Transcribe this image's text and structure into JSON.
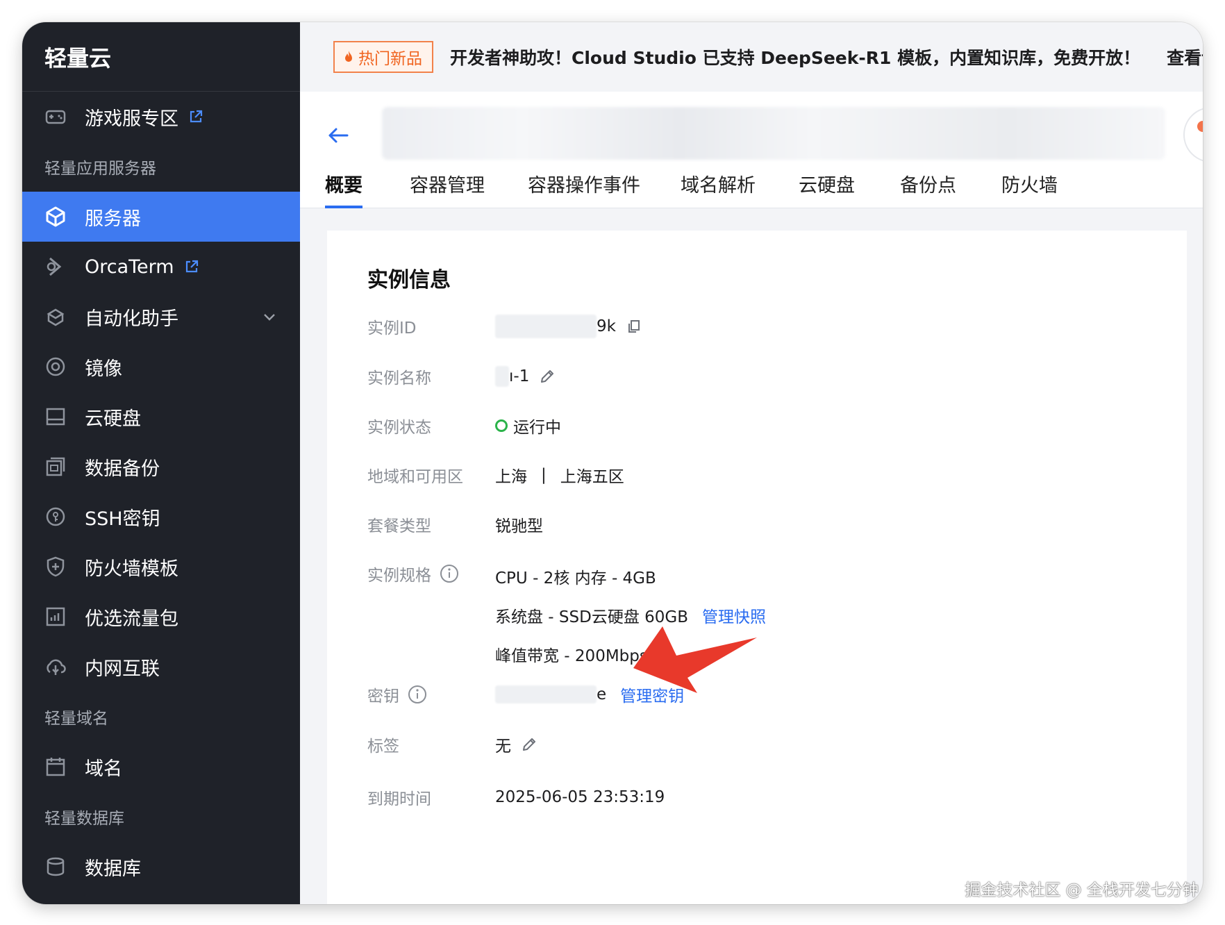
{
  "app": {
    "brand": "轻量云"
  },
  "sidebar": {
    "items": [
      {
        "type": "item",
        "name": "sidebar-item-game-server",
        "icon": "gamepad-icon",
        "label": "游戏服专区",
        "external": true
      },
      {
        "type": "group",
        "name": "sidebar-group-light-app",
        "label": "轻量应用服务器"
      },
      {
        "type": "item",
        "name": "sidebar-item-servers",
        "icon": "cube-icon",
        "label": "服务器",
        "active": true
      },
      {
        "type": "item",
        "name": "sidebar-item-orcaterm",
        "icon": "terminal-icon",
        "label": "OrcaTerm",
        "external": true
      },
      {
        "type": "item",
        "name": "sidebar-item-automation",
        "icon": "robot-icon",
        "label": "自动化助手",
        "expandable": true
      },
      {
        "type": "item",
        "name": "sidebar-item-images",
        "icon": "disc-icon",
        "label": "镜像"
      },
      {
        "type": "item",
        "name": "sidebar-item-cloud-disk",
        "icon": "disk-icon",
        "label": "云硬盘"
      },
      {
        "type": "item",
        "name": "sidebar-item-backup",
        "icon": "backup-icon",
        "label": "数据备份"
      },
      {
        "type": "item",
        "name": "sidebar-item-ssh-keys",
        "icon": "key-icon",
        "label": "SSH密钥"
      },
      {
        "type": "item",
        "name": "sidebar-item-firewall-templates",
        "icon": "shield-icon",
        "label": "防火墙模板"
      },
      {
        "type": "item",
        "name": "sidebar-item-traffic-package",
        "icon": "chart-icon",
        "label": "优选流量包"
      },
      {
        "type": "item",
        "name": "sidebar-item-intranet",
        "icon": "link-icon",
        "label": "内网互联"
      },
      {
        "type": "group",
        "name": "sidebar-group-domain",
        "label": "轻量域名"
      },
      {
        "type": "item",
        "name": "sidebar-item-domain",
        "icon": "calendar-icon",
        "label": "域名"
      },
      {
        "type": "group",
        "name": "sidebar-group-database",
        "label": "轻量数据库"
      },
      {
        "type": "item",
        "name": "sidebar-item-database",
        "icon": "database-icon",
        "label": "数据库"
      }
    ]
  },
  "banner": {
    "tag": "热门新品",
    "text": "开发者神助攻！Cloud Studio 已支持 DeepSeek-R1 模板，内置知识库，免费开放！",
    "more": "查看详情"
  },
  "tabs": [
    {
      "label": "概要",
      "active": true
    },
    {
      "label": "容器管理"
    },
    {
      "label": "容器操作事件"
    },
    {
      "label": "域名解析"
    },
    {
      "label": "云硬盘"
    },
    {
      "label": "备份点"
    },
    {
      "label": "防火墙"
    }
  ],
  "instance": {
    "title": "实例信息",
    "id_label": "实例ID",
    "id_suffix": "9k",
    "name_label": "实例名称",
    "name_suffix": "ı-1",
    "status_label": "实例状态",
    "status": "运行中",
    "status_color": "#2bb34a",
    "region_label": "地域和可用区",
    "region": "上海",
    "region_sep": "|",
    "zone": "上海五区",
    "plan_label": "套餐类型",
    "plan": "锐驰型",
    "spec_label": "实例规格",
    "spec_cpu": "CPU - 2核 内存 - 4GB",
    "spec_disk": "系统盘 - SSD云硬盘 60GB",
    "spec_snapshot_link": "管理快照",
    "spec_bandwidth": "峰值带宽 - 200Mbps",
    "key_label": "密钥",
    "key_suffix": "e",
    "key_manage_link": "管理密钥",
    "tag_label": "标签",
    "tag_value": "无",
    "expire_label": "到期时间",
    "expire_value": "2025-06-05 23:53:19"
  },
  "watermark": "掘金技术社区 @ 全栈开发七分钟",
  "colors": {
    "accent": "#2a6cf0",
    "sidebar_bg": "#1f2229",
    "sidebar_active": "#3f7af0",
    "arrow": "#e8392b"
  }
}
